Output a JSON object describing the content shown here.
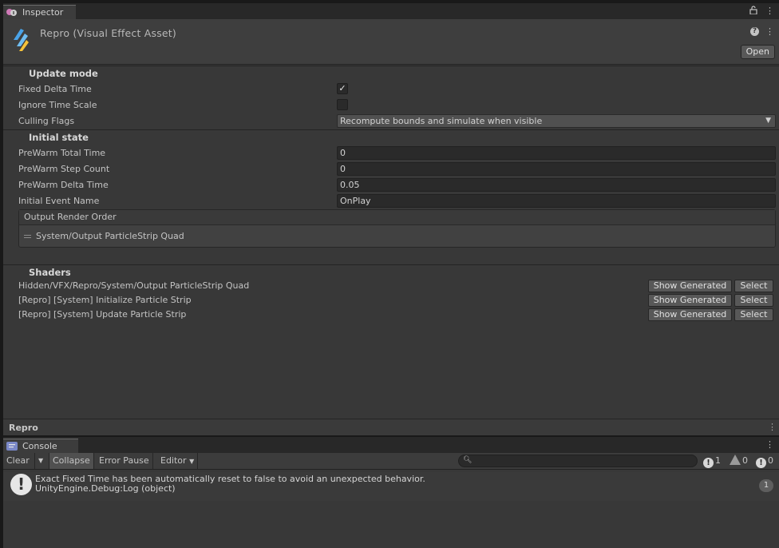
{
  "inspector": {
    "tab_label": "Inspector",
    "asset_title": "Repro (Visual Effect Asset)",
    "open_label": "Open",
    "footer_name": "Repro",
    "update_mode": {
      "title": "Update mode",
      "fixed_delta_time_label": "Fixed Delta Time",
      "fixed_delta_time_checked": true,
      "ignore_time_scale_label": "Ignore Time Scale",
      "ignore_time_scale_checked": false,
      "culling_flags_label": "Culling Flags",
      "culling_flags_value": "Recompute bounds and simulate when visible"
    },
    "initial_state": {
      "title": "Initial state",
      "prewarm_total_time_label": "PreWarm Total Time",
      "prewarm_total_time_value": "0",
      "prewarm_step_count_label": "PreWarm Step Count",
      "prewarm_step_count_value": "0",
      "prewarm_delta_time_label": "PreWarm Delta Time",
      "prewarm_delta_time_value": "0.05",
      "initial_event_name_label": "Initial Event Name",
      "initial_event_name_value": "OnPlay"
    },
    "output_render_order": {
      "title": "Output Render Order",
      "items": [
        "System/Output ParticleStrip Quad"
      ]
    },
    "shaders": {
      "title": "Shaders",
      "show_generated_label": "Show Generated",
      "select_label": "Select",
      "items": [
        "Hidden/VFX/Repro/System/Output ParticleStrip Quad",
        "[Repro] [System] Initialize Particle Strip",
        "[Repro] [System] Update Particle Strip"
      ]
    }
  },
  "console": {
    "tab_label": "Console",
    "clear_label": "Clear",
    "collapse_label": "Collapse",
    "error_pause_label": "Error Pause",
    "editor_label": "Editor",
    "search_placeholder": "",
    "info_count": "1",
    "warning_count": "0",
    "error_count": "0",
    "entries": [
      {
        "line1": "Exact Fixed Time has been automatically reset to false to avoid an unexpected behavior.",
        "line2": "UnityEngine.Debug:Log (object)",
        "count": "1"
      }
    ]
  },
  "colors": {
    "panel_bg": "#383838",
    "field_bg": "#2a2a2a",
    "logo_blue": "#4aa3e8",
    "logo_yellow": "#f5c23a"
  }
}
